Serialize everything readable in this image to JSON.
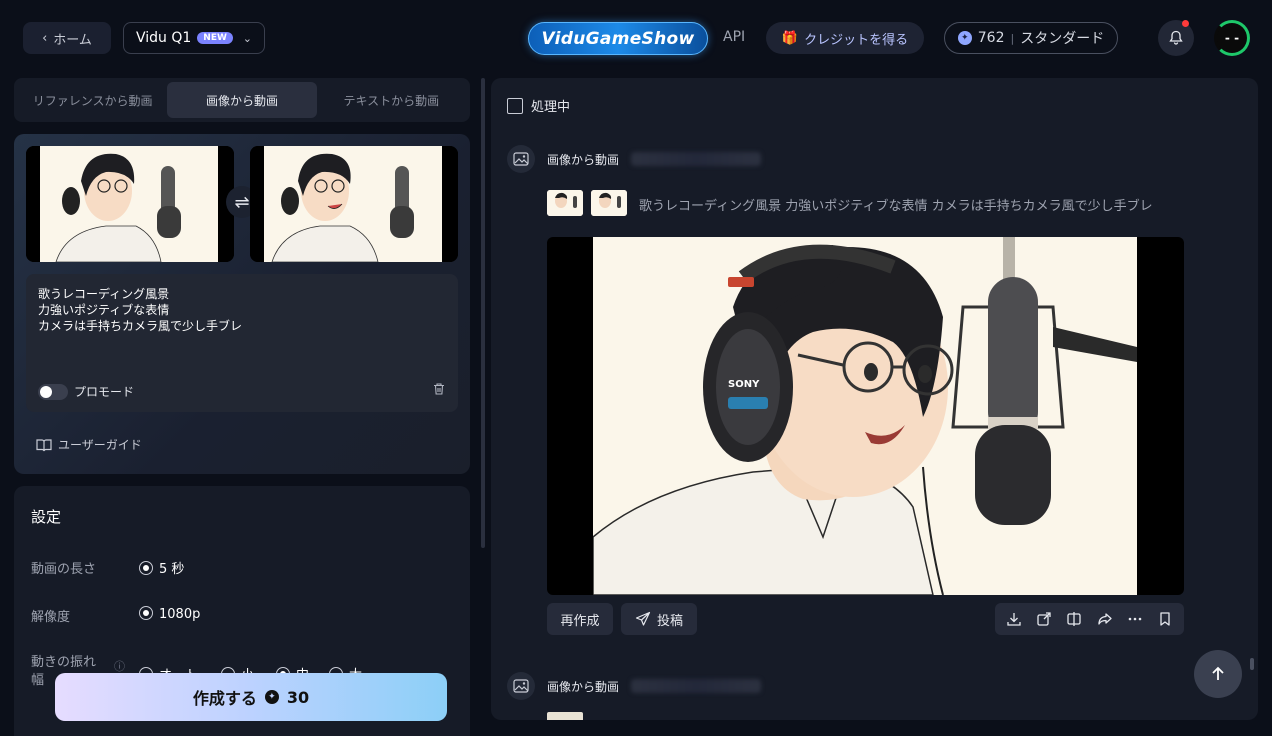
{
  "header": {
    "home_label": "ホーム",
    "model_name": "Vidu Q1",
    "model_badge": "NEW",
    "logo_text": "ViduGameShow",
    "api_label": "API",
    "credit_label": "クレジットを得る",
    "credits": "762",
    "plan": "スタンダード",
    "avatar_text": "- -"
  },
  "tabs": [
    {
      "label": "リファレンスから動画",
      "active": false
    },
    {
      "label": "画像から動画",
      "active": true
    },
    {
      "label": "テキストから動画",
      "active": false
    }
  ],
  "prompt": {
    "text": "歌うレコーディング風景\n力強いポジティブな表情\nカメラは手持ちカメラ風で少し手ブレ",
    "pro_mode_label": "プロモード",
    "pro_mode_on": false
  },
  "user_guide_label": "ユーザーガイド",
  "settings": {
    "title": "設定",
    "duration_label": "動画の長さ",
    "duration_value": "5 秒",
    "resolution_label": "解像度",
    "resolution_value": "1080p",
    "motion_label": "動きの振れ幅",
    "motion_options": [
      "オート",
      "小",
      "中",
      "大"
    ],
    "motion_selected": "中"
  },
  "create_button": {
    "label": "作成する",
    "cost": "30"
  },
  "results": {
    "processing_label": "処理中",
    "entries": [
      {
        "type_label": "画像から動画",
        "prompt": "歌うレコーディング風景 力強いポジティブな表情 カメラは手持ちカメラ風で少し手ブレ",
        "recreate_label": "再作成",
        "post_label": "投稿"
      },
      {
        "type_label": "画像から動画"
      }
    ]
  },
  "icons": [
    "chevron-left-icon",
    "chevron-down-icon",
    "gift-icon",
    "credit-icon",
    "bell-icon",
    "swap-icon",
    "trash-icon",
    "book-icon",
    "info-icon",
    "coin-icon",
    "image-video-icon",
    "send-icon",
    "download-icon",
    "external-icon",
    "compare-icon",
    "share-icon",
    "more-icon",
    "bookmark-icon",
    "arrow-up-icon"
  ],
  "colors": {
    "background": "#0b0f19",
    "panel": "#161b27",
    "accent": "#7b83ff",
    "notification": "#ff3b3b",
    "status": "#1ec86a"
  }
}
